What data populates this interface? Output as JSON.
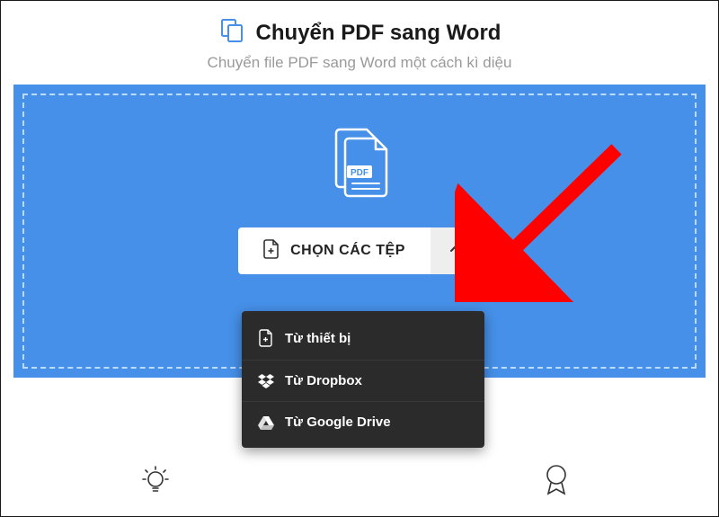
{
  "header": {
    "title": "Chuyển PDF sang Word",
    "subtitle": "Chuyển file PDF sang Word một cách kì diệu"
  },
  "chooser": {
    "button_label": "CHỌN CÁC TỆP",
    "pdf_badge": "PDF"
  },
  "menu": {
    "items": [
      {
        "label": "Từ thiết bị"
      },
      {
        "label": "Từ Dropbox"
      },
      {
        "label": "Từ Google Drive"
      }
    ]
  }
}
